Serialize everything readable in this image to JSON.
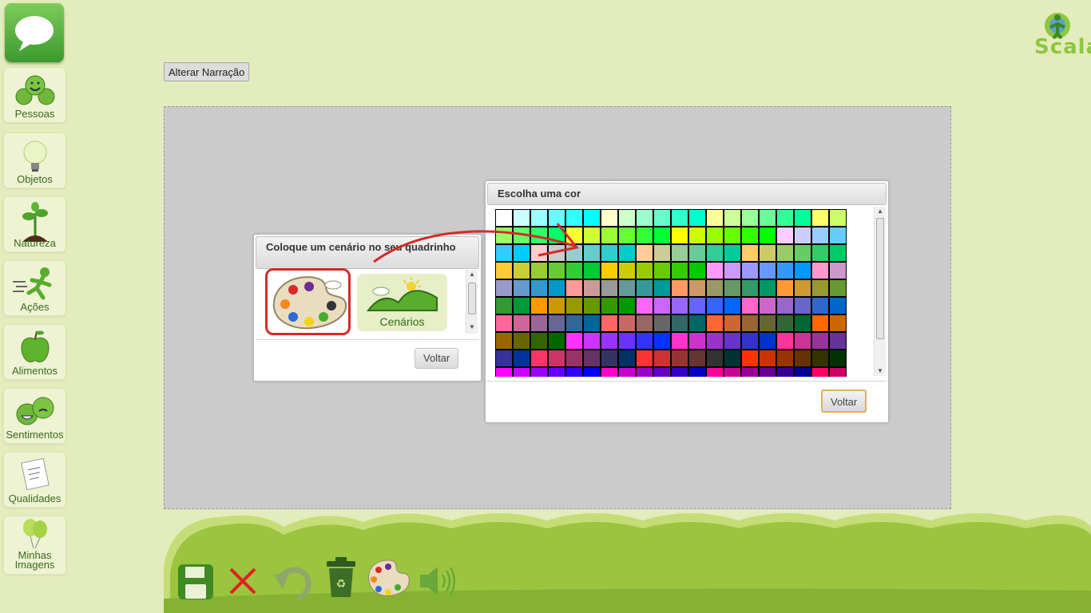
{
  "sidebar": {
    "items": [
      {
        "label": "Pessoas",
        "icon": "people-icon"
      },
      {
        "label": "Objetos",
        "icon": "lightbulb-icon"
      },
      {
        "label": "Natureza",
        "icon": "plant-icon"
      },
      {
        "label": "Ações",
        "icon": "running-person-icon"
      },
      {
        "label": "Alimentos",
        "icon": "apple-icon"
      },
      {
        "label": "Sentimentos",
        "icon": "emotion-faces-icon"
      },
      {
        "label": "Qualidades",
        "icon": "notepad-icon"
      },
      {
        "label": "Minhas Imagens",
        "icon": "balloons-icon"
      }
    ],
    "chat_icon": "speech-bubble-icon"
  },
  "narracao_button": "Alterar Narração",
  "logo_text": "Scala",
  "scenario_dialog": {
    "title": "Coloque um cenário no seu quadrinho",
    "options": [
      {
        "label": "",
        "icon": "palette-icon"
      },
      {
        "label": "Cenários",
        "icon": "landscape-icon"
      }
    ],
    "back": "Voltar"
  },
  "color_dialog": {
    "title": "Escolha uma cor",
    "back": "Voltar",
    "colors": [
      [
        "#ffffff",
        "#ccffff",
        "#99ffff",
        "#66ffff",
        "#33ffff",
        "#00ffff",
        "#ffffcc",
        "#ccffcc",
        "#99ffcc",
        "#66ffcc",
        "#33ffcc",
        "#00ffcc",
        "#ffff99",
        "#ccff99",
        "#99ff99",
        "#66ff99",
        "#33ff99",
        "#00ff99",
        "#ffff66",
        "#ccff66"
      ],
      [
        "#99ff66",
        "#66ff66",
        "#33ff66",
        "#00ff66",
        "#ffff33",
        "#ccff33",
        "#99ff33",
        "#66ff33",
        "#33ff33",
        "#00ff33",
        "#ffff00",
        "#ccff00",
        "#99ff00",
        "#66ff00",
        "#33ff00",
        "#00ff00",
        "#ffccff",
        "#ccccff",
        "#99ccff",
        "#66ccff"
      ],
      [
        "#33ccff",
        "#00ccff",
        "#ffcccc",
        "#cccccc",
        "#99cccc",
        "#66cccc",
        "#33cccc",
        "#00cccc",
        "#ffcc99",
        "#cccc99",
        "#99cc99",
        "#66cc99",
        "#33cc99",
        "#00cc99",
        "#ffcc66",
        "#cccc66",
        "#99cc66",
        "#66cc66",
        "#33cc66",
        "#00cc66"
      ],
      [
        "#ffcc33",
        "#cccc33",
        "#99cc33",
        "#66cc33",
        "#33cc33",
        "#00cc33",
        "#ffcc00",
        "#cccc00",
        "#99cc00",
        "#66cc00",
        "#33cc00",
        "#00cc00",
        "#ff99ff",
        "#cc99ff",
        "#9999ff",
        "#6699ff",
        "#3399ff",
        "#0099ff",
        "#ff99cc",
        "#cc99cc"
      ],
      [
        "#9999cc",
        "#6699cc",
        "#3399cc",
        "#0099cc",
        "#ff9999",
        "#cc9999",
        "#999999",
        "#669999",
        "#339999",
        "#009999",
        "#ff9966",
        "#cc9966",
        "#999966",
        "#669966",
        "#339966",
        "#009966",
        "#ff9933",
        "#cc9933",
        "#999933",
        "#669933"
      ],
      [
        "#339933",
        "#009933",
        "#ff9900",
        "#cc9900",
        "#999900",
        "#669900",
        "#339900",
        "#009900",
        "#ff66ff",
        "#cc66ff",
        "#9966ff",
        "#6666ff",
        "#3366ff",
        "#0066ff",
        "#ff66cc",
        "#cc66cc",
        "#9966cc",
        "#6666cc",
        "#3366cc",
        "#0066cc"
      ],
      [
        "#ff6699",
        "#cc6699",
        "#996699",
        "#666699",
        "#336699",
        "#006699",
        "#ff6666",
        "#cc6666",
        "#996666",
        "#666666",
        "#336666",
        "#006666",
        "#ff6633",
        "#cc6633",
        "#996633",
        "#666633",
        "#336633",
        "#006633",
        "#ff6600",
        "#cc6600"
      ],
      [
        "#996600",
        "#666600",
        "#336600",
        "#006600",
        "#ff33ff",
        "#cc33ff",
        "#9933ff",
        "#6633ff",
        "#3333ff",
        "#0033ff",
        "#ff33cc",
        "#cc33cc",
        "#9933cc",
        "#6633cc",
        "#3333cc",
        "#0033cc",
        "#ff3399",
        "#cc3399",
        "#993399",
        "#663399"
      ],
      [
        "#333399",
        "#003399",
        "#ff3366",
        "#cc3366",
        "#993366",
        "#663366",
        "#333366",
        "#003366",
        "#ff3333",
        "#cc3333",
        "#993333",
        "#663333",
        "#333333",
        "#003333",
        "#ff3300",
        "#cc3300",
        "#993300",
        "#663300",
        "#333300",
        "#003300"
      ],
      [
        "#ff00ff",
        "#cc00ff",
        "#9900ff",
        "#6600ff",
        "#3300ff",
        "#0000ff",
        "#ff00cc",
        "#cc00cc",
        "#9900cc",
        "#6600cc",
        "#3300cc",
        "#0000cc",
        "#ff0099",
        "#cc0099",
        "#990099",
        "#660099",
        "#330099",
        "#000099",
        "#ff0066",
        "#cc0066"
      ]
    ]
  },
  "toolbar": [
    {
      "name": "save-icon"
    },
    {
      "name": "close-icon"
    },
    {
      "name": "undo-icon"
    },
    {
      "name": "recycle-bin-icon"
    },
    {
      "name": "palette-icon"
    },
    {
      "name": "speaker-icon"
    }
  ]
}
